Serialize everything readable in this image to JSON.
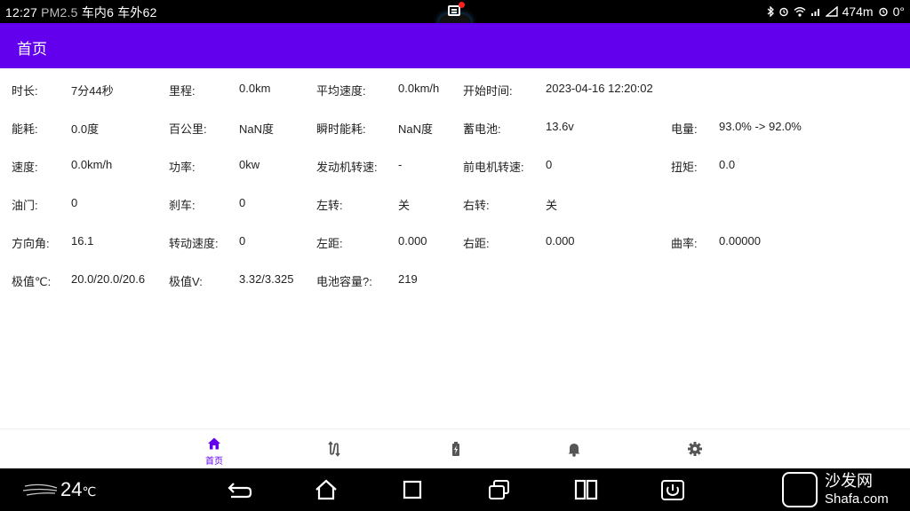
{
  "status_bar": {
    "time": "12:27",
    "pm25_label": "PM2.5",
    "inside_label": "车内",
    "inside_value": "6",
    "outside_label": "车外",
    "outside_value": "62",
    "data_usage": "474m",
    "extra": "0°",
    "notification_dot_color": "#ff1f1f"
  },
  "app_bar": {
    "title": "首页",
    "color": "#6200ee"
  },
  "rows": [
    [
      {
        "label": "时长:",
        "value": "7分44秒"
      },
      {
        "label": "里程:",
        "value": "0.0km"
      },
      {
        "label": "平均速度:",
        "value": "0.0km/h"
      },
      {
        "label": "开始时间:",
        "value": "2023-04-16 12:20:02"
      }
    ],
    [
      {
        "label": "能耗:",
        "value": "0.0度"
      },
      {
        "label": "百公里:",
        "value": "NaN度"
      },
      {
        "label": "瞬时能耗:",
        "value": "NaN度"
      },
      {
        "label": "蓄电池:",
        "value": "13.6v"
      },
      {
        "label": "电量:",
        "value": "93.0% -> 92.0%"
      }
    ],
    [
      {
        "label": "速度:",
        "value": "0.0km/h"
      },
      {
        "label": "功率:",
        "value": "0kw"
      },
      {
        "label": "发动机转速:",
        "value": "-"
      },
      {
        "label": "前电机转速:",
        "value": "0"
      },
      {
        "label": "扭矩:",
        "value": "0.0"
      }
    ],
    [
      {
        "label": "油门:",
        "value": "0"
      },
      {
        "label": "刹车:",
        "value": "0"
      },
      {
        "label": "左转:",
        "value": "关"
      },
      {
        "label": "右转:",
        "value": "关"
      }
    ],
    [
      {
        "label": "方向角:",
        "value": "16.1"
      },
      {
        "label": "转动速度:",
        "value": "0"
      },
      {
        "label": "左距:",
        "value": "0.000"
      },
      {
        "label": "右距:",
        "value": "0.000"
      },
      {
        "label": "曲率:",
        "value": "0.00000"
      }
    ],
    [
      {
        "label": "极值℃:",
        "value": "20.0/20.0/20.6"
      },
      {
        "label": "极值V:",
        "value": "3.32/3.325"
      },
      {
        "label": "电池容量?:",
        "value": "219"
      }
    ]
  ],
  "bottom_nav": {
    "items": [
      {
        "icon": "home-icon",
        "label": "首页",
        "selected": true
      },
      {
        "icon": "route-icon",
        "label": "",
        "selected": false
      },
      {
        "icon": "battery-charging-icon",
        "label": "",
        "selected": false
      },
      {
        "icon": "bell-icon",
        "label": "",
        "selected": false
      },
      {
        "icon": "settings-icon",
        "label": "",
        "selected": false
      }
    ],
    "selected_color": "#6200ee",
    "unselected_color": "#555555"
  },
  "system_bar": {
    "temperature": "24",
    "temperature_unit": "℃",
    "buttons": [
      "back-icon",
      "home-icon",
      "recents-icon",
      "screenshot-icon",
      "split-screen-icon",
      "power-icon"
    ]
  },
  "watermark": {
    "text": "沙发网",
    "url": "Shafa.com"
  }
}
